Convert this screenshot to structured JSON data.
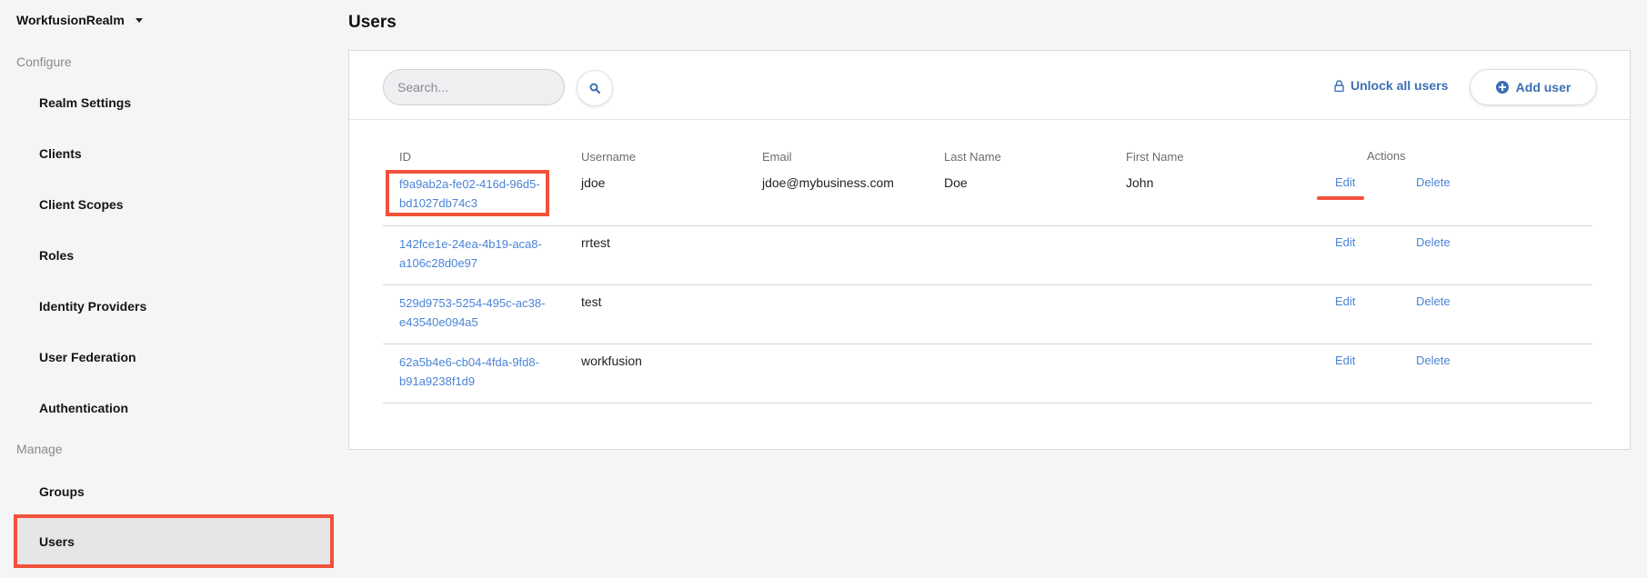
{
  "sidebar": {
    "realm_name": "WorkfusionRealm",
    "configure_label": "Configure",
    "configure_items": [
      {
        "label": "Realm Settings"
      },
      {
        "label": "Clients"
      },
      {
        "label": "Client Scopes"
      },
      {
        "label": "Roles"
      },
      {
        "label": "Identity Providers"
      },
      {
        "label": "User Federation"
      },
      {
        "label": "Authentication"
      }
    ],
    "manage_label": "Manage",
    "manage_items": [
      {
        "label": "Groups"
      },
      {
        "label": "Users",
        "active": true
      }
    ]
  },
  "main": {
    "title": "Users",
    "search": {
      "placeholder": "Search...",
      "value": ""
    },
    "unlock_all_label": "Unlock all users",
    "add_user_label": "Add user",
    "table": {
      "columns": [
        "ID",
        "Username",
        "Email",
        "Last Name",
        "First Name",
        "Actions"
      ],
      "rows": [
        {
          "id_line1": "f9a9ab2a-fe02-416d-96d5-",
          "id_line2": "bd1027db74c3",
          "username": "jdoe",
          "email": "jdoe@mybusiness.com",
          "last_name": "Doe",
          "first_name": "John",
          "edit": "Edit",
          "delete": "Delete"
        },
        {
          "id_line1": "142fce1e-24ea-4b19-aca8-",
          "id_line2": "a106c28d0e97",
          "username": "rrtest",
          "email": "",
          "last_name": "",
          "first_name": "",
          "edit": "Edit",
          "delete": "Delete"
        },
        {
          "id_line1": "529d9753-5254-495c-ac38-",
          "id_line2": "e43540e094a5",
          "username": "test",
          "email": "",
          "last_name": "",
          "first_name": "",
          "edit": "Edit",
          "delete": "Delete"
        },
        {
          "id_line1": "62a5b4e6-cb04-4fda-9fd8-",
          "id_line2": "b91a9238f1d9",
          "username": "workfusion",
          "email": "",
          "last_name": "",
          "first_name": "",
          "edit": "Edit",
          "delete": "Delete"
        }
      ]
    }
  },
  "colors": {
    "highlight": "#f2513b",
    "link": "#4a84d6",
    "accent": "#3c6fb4"
  }
}
